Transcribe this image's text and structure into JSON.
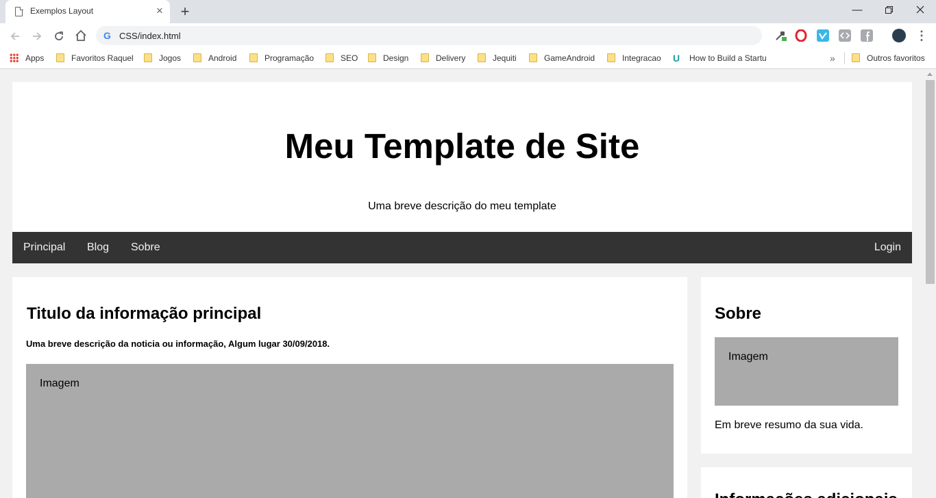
{
  "browser": {
    "tab_title": "Exemplos Layout",
    "new_tab_symbol": "+",
    "url": "CSS/index.html",
    "bookmarks": [
      {
        "label": "Apps",
        "icon": "apps-grid-icon"
      },
      {
        "label": "Favoritos Raquel",
        "icon": "folder-icon"
      },
      {
        "label": "Jogos",
        "icon": "folder-icon"
      },
      {
        "label": "Android",
        "icon": "folder-icon"
      },
      {
        "label": "Programação",
        "icon": "folder-icon"
      },
      {
        "label": "SEO",
        "icon": "folder-icon"
      },
      {
        "label": "Design",
        "icon": "folder-icon"
      },
      {
        "label": "Delivery",
        "icon": "folder-icon"
      },
      {
        "label": "Jequiti",
        "icon": "folder-icon"
      },
      {
        "label": "GameAndroid",
        "icon": "folder-icon"
      },
      {
        "label": "Integracao",
        "icon": "folder-icon"
      },
      {
        "label": "How to Build a Startu",
        "icon": "udemy-icon"
      }
    ],
    "more_bookmarks": "»",
    "other_favorites": "Outros favoritos"
  },
  "page": {
    "header": {
      "title": "Meu Template de Site",
      "description": "Uma breve descrição do meu template"
    },
    "nav": {
      "links": [
        "Principal",
        "Blog",
        "Sobre"
      ],
      "login": "Login"
    },
    "main": {
      "title": "Titulo da informação principal",
      "meta": "Uma breve descrição da noticia ou informação, Algum lugar 30/09/2018.",
      "image_label": "Imagem"
    },
    "sidebar": {
      "about_title": "Sobre",
      "about_image_label": "Imagem",
      "about_text": "Em breve resumo da sua vida.",
      "second_title": "Informações adicionais"
    }
  },
  "colors": {
    "nav_bg": "#333333",
    "image_placeholder": "#aaaaaa",
    "page_bg": "#f1f1f1"
  }
}
